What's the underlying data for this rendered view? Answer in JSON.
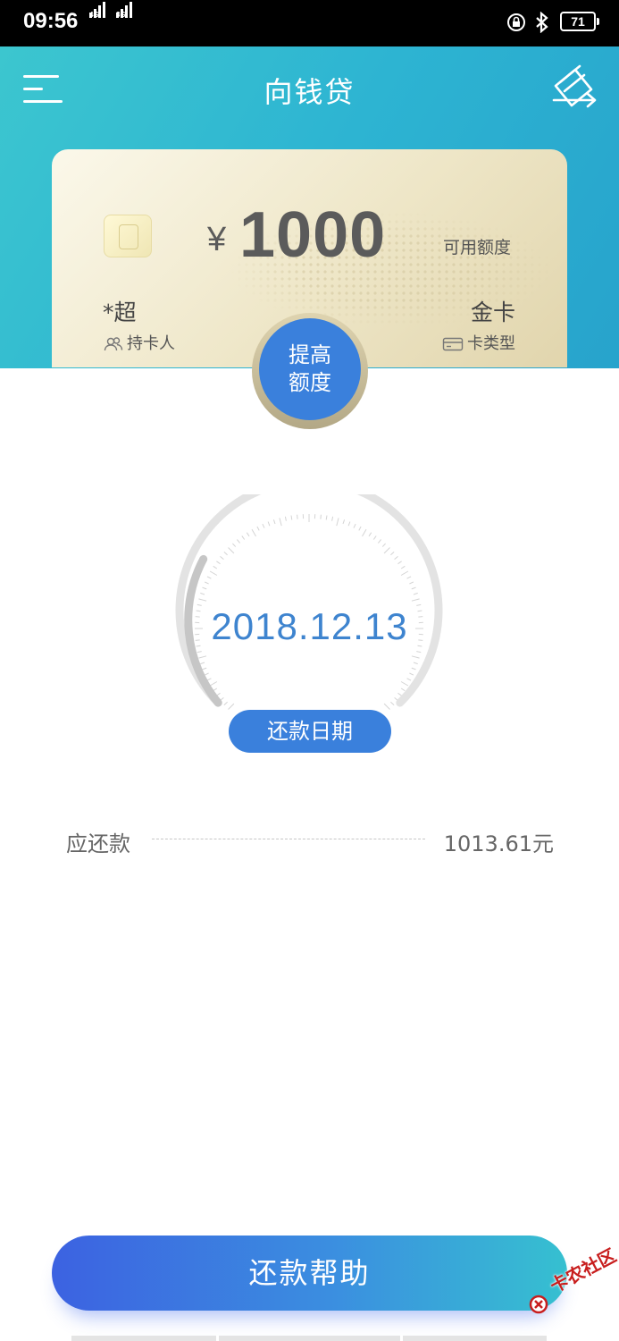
{
  "status_bar": {
    "time": "09:56",
    "network_1": "4G",
    "network_2": "3G",
    "battery": "71"
  },
  "header": {
    "title": "向钱贷",
    "menu_icon": "menu-icon",
    "right_icon": "card-switch-icon",
    "background": "#2db4d2"
  },
  "card": {
    "currency": "¥",
    "amount": "1000",
    "amount_label": "可用额度",
    "holder_name": "*超",
    "holder_label": "持卡人",
    "card_type": "金卡",
    "card_type_label": "卡类型",
    "chip_icon": "card-chip-icon"
  },
  "raise_limit_button": {
    "line1": "提高",
    "line2": "额度",
    "color": "#3a80dc"
  },
  "repayment": {
    "date": "2018.12.13",
    "date_label": "还款日期",
    "amount_due_label": "应还款",
    "amount_due_value": "1013.61元"
  },
  "footer": {
    "help_button": "还款帮助"
  },
  "watermark": {
    "text": "卡农社区"
  }
}
